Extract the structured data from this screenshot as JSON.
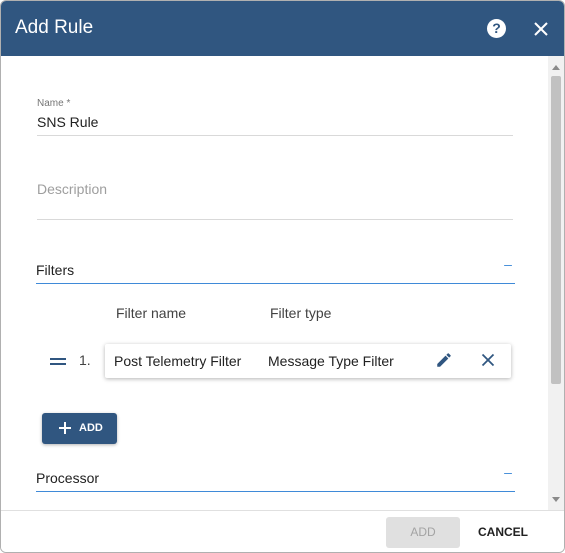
{
  "dialog": {
    "title": "Add Rule",
    "help_icon": "help-icon",
    "close_icon": "close-icon",
    "header_color": "#305680"
  },
  "form": {
    "name": {
      "label": "Name *",
      "value": "SNS Rule"
    },
    "description": {
      "placeholder": "Description",
      "value": ""
    }
  },
  "filters": {
    "section_title": "Filters",
    "collapse_symbol": "–",
    "columns": {
      "filter_name": "Filter name",
      "filter_type": "Filter type"
    },
    "rows": [
      {
        "index": "1.",
        "filter_name": "Post Telemetry Filter",
        "filter_type": "Message Type Filter",
        "edit_icon": "pencil-icon",
        "remove_icon": "close-icon"
      }
    ],
    "add_button": {
      "label": "ADD",
      "icon": "plus-icon"
    }
  },
  "processor": {
    "section_title": "Processor",
    "collapse_symbol": "–"
  },
  "footer": {
    "add_label": "ADD",
    "cancel_label": "CANCEL"
  },
  "accent_color": "#3f8ad8"
}
